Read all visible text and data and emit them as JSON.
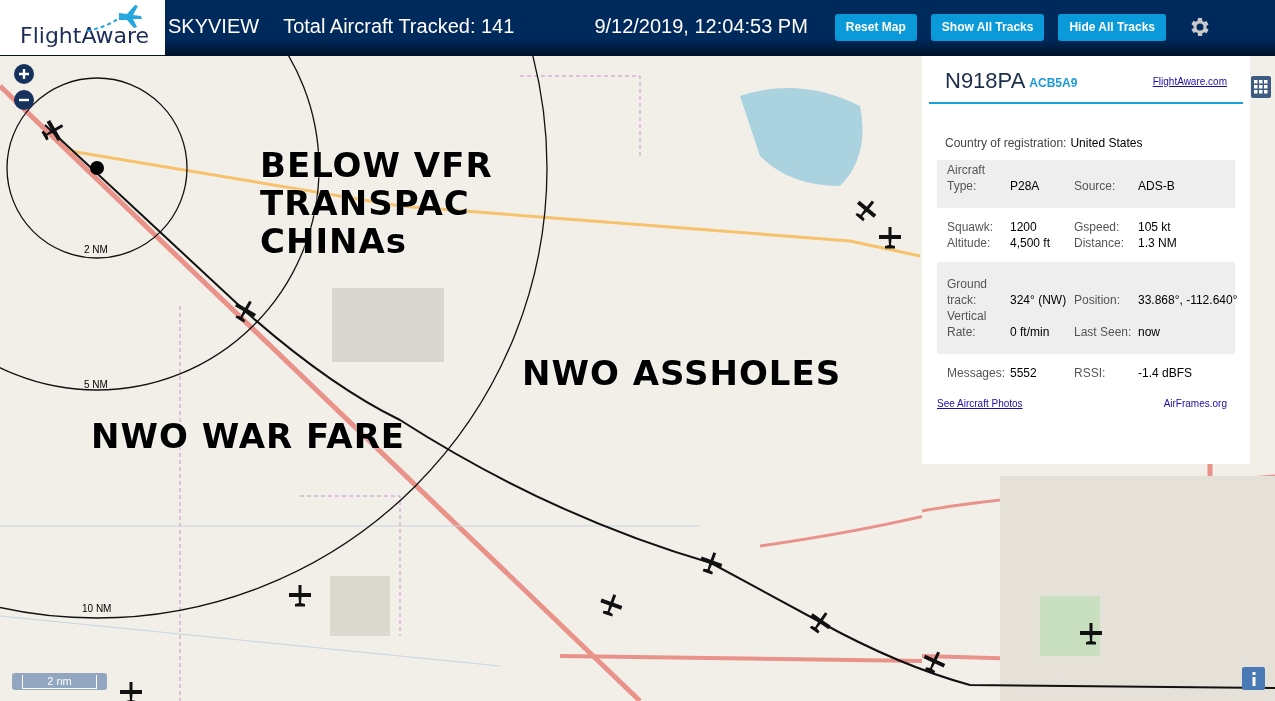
{
  "header": {
    "logo_text": "FlightAware",
    "title": "SKYVIEW",
    "total": "Total Aircraft Tracked: 141",
    "datetime": "9/12/2019, 12:04:53 PM",
    "buttons": [
      "Reset Map",
      "Show All Tracks",
      "Hide All Tracks"
    ]
  },
  "map": {
    "ring_labels": [
      "2 NM",
      "5 NM",
      "10 NM"
    ],
    "scale": "2 nm",
    "annotations": [
      {
        "lines": [
          "BELOW VFR",
          "TRANSPAC",
          "CHINAs"
        ]
      },
      {
        "lines": [
          "NWO ASSHOLES"
        ]
      },
      {
        "lines": [
          "NWO WAR FARE"
        ]
      }
    ]
  },
  "panel": {
    "registration": "N918PA",
    "hex": "ACB5A9",
    "link": "FlightAware.com",
    "country_label": "Country of registration:",
    "country": "United States",
    "sections": [
      {
        "shaded": true,
        "rows": [
          [
            "Aircraft Type:",
            "P28A",
            "Source:",
            "ADS-B"
          ]
        ]
      },
      {
        "shaded": false,
        "rows": [
          [
            "Squawk:",
            "1200",
            "Gspeed:",
            "105 kt"
          ],
          [
            "Altitude:",
            "4,500 ft",
            "Distance:",
            "1.3 NM"
          ]
        ]
      },
      {
        "shaded": true,
        "rows": [
          [
            "Ground track:",
            "324° (NW)",
            "Position:",
            "33.868°, -112.640°"
          ],
          [
            "Vertical Rate:",
            "0 ft/min",
            "Last Seen:",
            "now"
          ]
        ]
      },
      {
        "shaded": false,
        "rows": [
          [
            "Messages:",
            "5552",
            "RSSI:",
            "-1.4 dBFS"
          ]
        ]
      }
    ],
    "photos_link": "See Aircraft Photos",
    "airframes_link": "AirFrames.org"
  }
}
